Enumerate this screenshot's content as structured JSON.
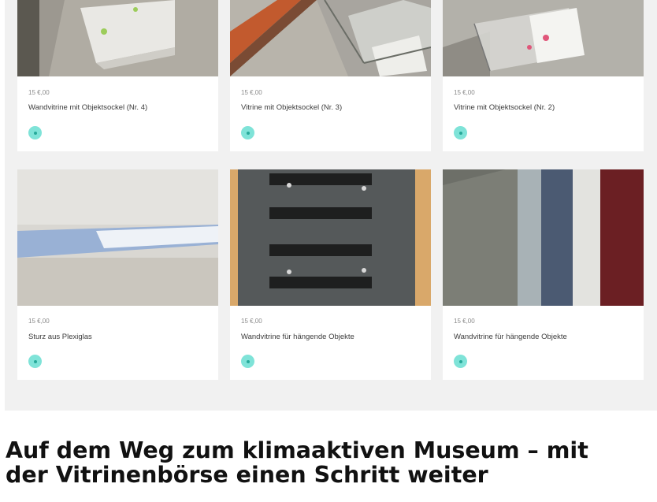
{
  "gallery": {
    "items": [
      {
        "price": "15 €,00",
        "title": "Wandvitrine mit Objektsockel (Nr. 4)",
        "image": "wandvitrine-objektsockel-photo",
        "icon": "plus-icon"
      },
      {
        "price": "15 €,00",
        "title": "Vitrine mit Objektsockel (Nr. 3)",
        "image": "vitrine-objektsockel-photo",
        "icon": "plus-icon"
      },
      {
        "price": "15 €,00",
        "title": "Vitrine mit Objektsockel (Nr. 2)",
        "image": "vitrine-objektsockel-photo",
        "icon": "plus-icon"
      },
      {
        "price": "15 €,00",
        "title": "Sturz aus Plexiglas",
        "image": "plexiglas-sturz-photo",
        "icon": "plus-icon"
      },
      {
        "price": "15 €,00",
        "title": "Wandvitrine für hängende Objekte",
        "image": "wandvitrine-haengend-photo",
        "icon": "plus-icon"
      },
      {
        "price": "15 €,00",
        "title": "Wandvitrine für hängende Objekte",
        "image": "wandvitrine-haengend-photo",
        "icon": "plus-icon"
      }
    ]
  },
  "article": {
    "headline_line1": "Auf dem Weg zum klimaaktiven Museum – mit",
    "headline_line2": "der Vitrinenbörse einen Schritt weiter"
  },
  "colors": {
    "accent": "#7fe3d8",
    "background": "#f1f1f1",
    "card": "#ffffff"
  }
}
